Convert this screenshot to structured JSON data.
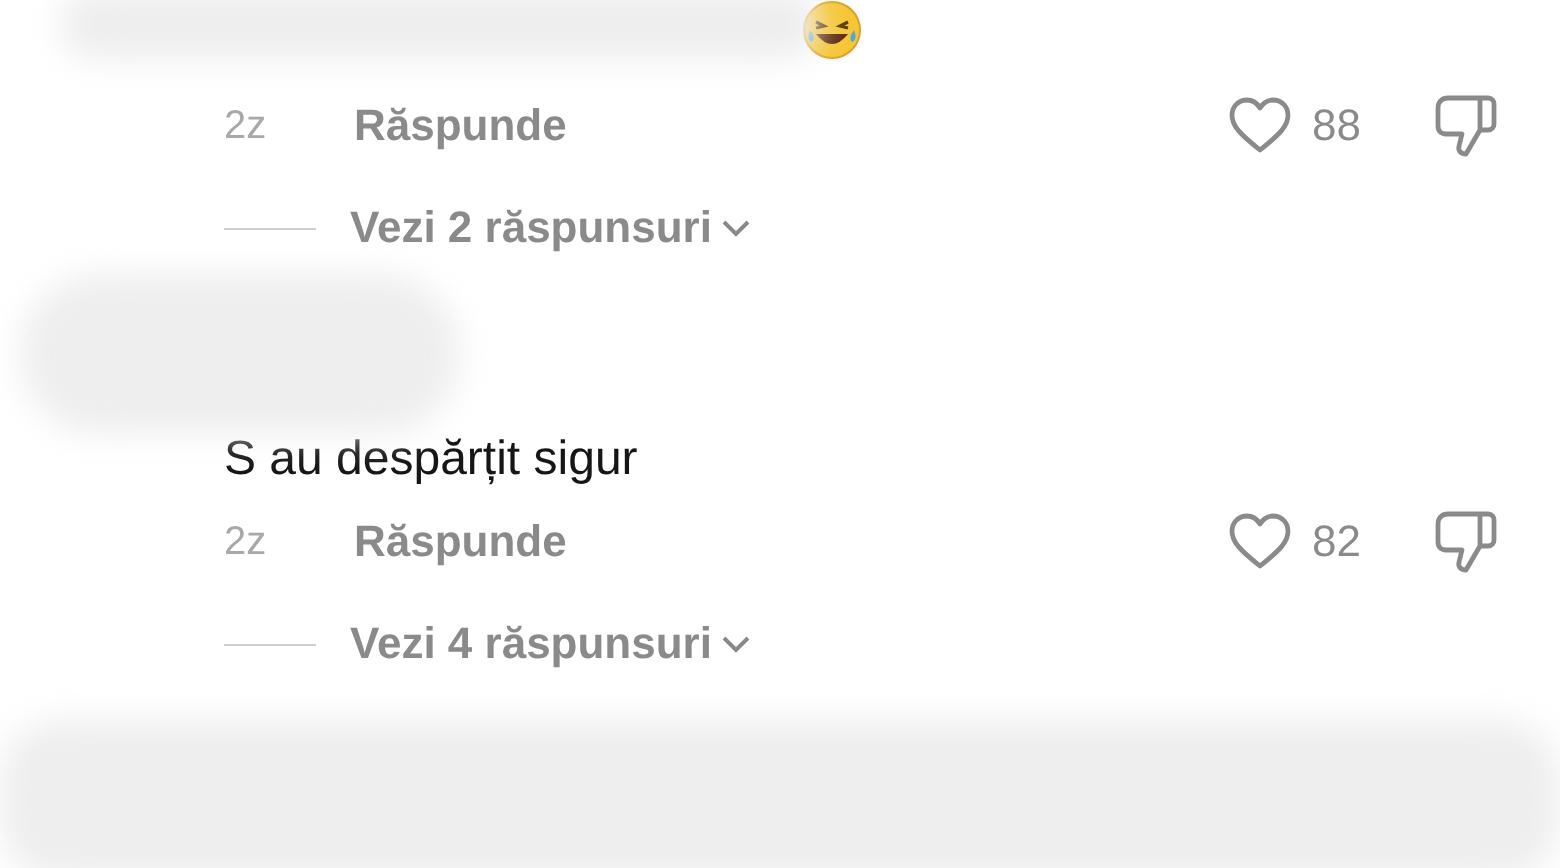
{
  "comments": [
    {
      "time": "2z",
      "reply": "Răspunde",
      "likes": "88",
      "view_replies": "Vezi 2 răspunsuri"
    },
    {
      "text": "S au despărțit sigur",
      "time": "2z",
      "reply": "Răspunde",
      "likes": "82",
      "view_replies": "Vezi 4 răspunsuri"
    }
  ]
}
